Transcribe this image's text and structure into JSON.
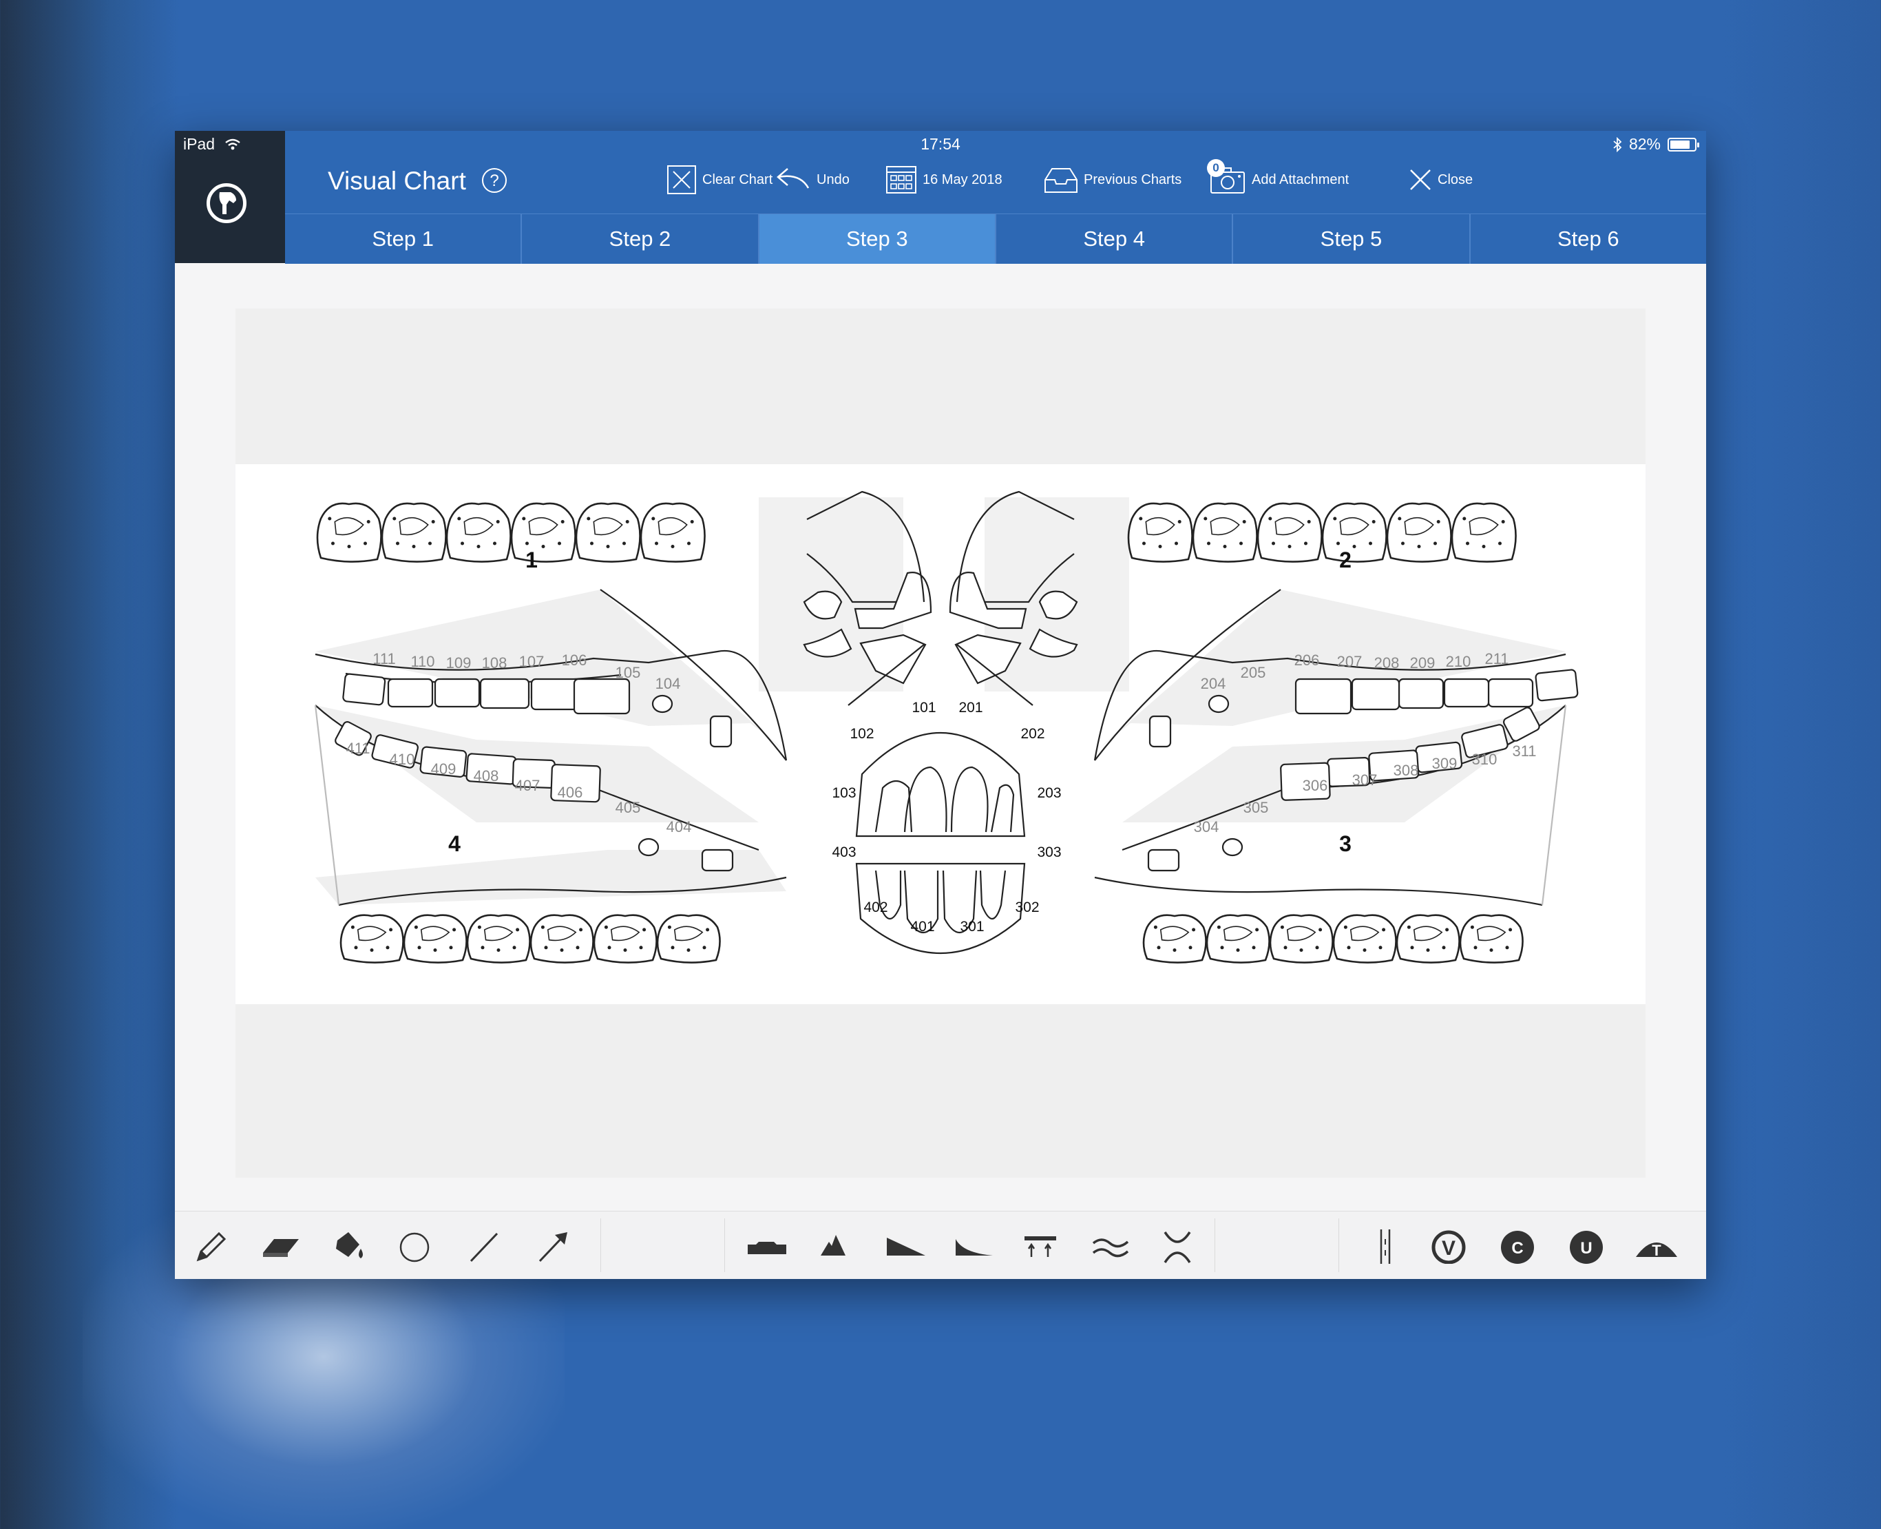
{
  "status_bar": {
    "device": "iPad",
    "time": "17:54",
    "battery": "82%",
    "battery_level": 0.82
  },
  "header": {
    "title": "Visual Chart",
    "help_icon": "?"
  },
  "toolbar_actions": {
    "clear_chart": "Clear Chart",
    "undo": "Undo",
    "date": "16 May 2018",
    "previous_charts": "Previous Charts",
    "attachment_count": "0",
    "add_attachment": "Add Attachment",
    "close": "Close"
  },
  "tabs": [
    "Step 1",
    "Step 2",
    "Step 3",
    "Step 4",
    "Step 5",
    "Step 6"
  ],
  "active_tab": "Step 3",
  "dental_chart": {
    "quadrants": [
      "1",
      "2",
      "3",
      "4"
    ],
    "upper_right_teeth": [
      "111",
      "110",
      "109",
      "108",
      "107",
      "106",
      "105",
      "104"
    ],
    "upper_left_teeth": [
      "204",
      "205",
      "206",
      "207",
      "208",
      "209",
      "210",
      "211"
    ],
    "lower_left_teeth": [
      "311",
      "310",
      "309",
      "308",
      "307",
      "306",
      "305",
      "304"
    ],
    "lower_right_teeth": [
      "411",
      "410",
      "409",
      "408",
      "407",
      "406",
      "405",
      "404"
    ],
    "incisors_upper": [
      "101",
      "201",
      "102",
      "202",
      "103",
      "203"
    ],
    "incisors_lower": [
      "403",
      "303",
      "402",
      "302",
      "401",
      "301"
    ]
  },
  "drawing_tools": [
    "pencil-icon",
    "eraser-icon",
    "fill-bucket-icon",
    "circle-icon",
    "line-icon",
    "arrow-icon"
  ],
  "shape_tools": [
    "flat-cap-icon",
    "hook-icon",
    "ramp-icon",
    "wave-ramp-icon",
    "overbite-icon",
    "wave-icon",
    "diastema-icon"
  ],
  "marker_tools": [
    "divider-icon",
    "V",
    "C",
    "U",
    "T"
  ],
  "colors": {
    "header_blue": "#2d68b4",
    "active_tab": "#4a8fd8",
    "logo_block": "#1f2a37"
  }
}
